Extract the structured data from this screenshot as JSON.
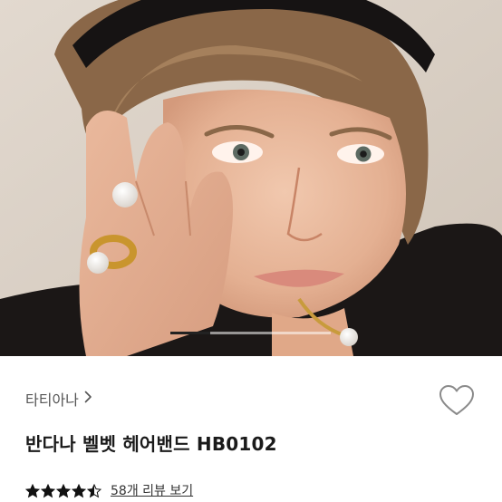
{
  "brand": {
    "name": "타티아나",
    "chevron_icon": "chevron-right-icon"
  },
  "product": {
    "title": "반다나 벨벳 헤어밴드 HB0102"
  },
  "rating": {
    "value": 4.5,
    "max": 5,
    "review_link": "58개 리뷰 보기"
  },
  "carousel": {
    "progress": 0.25
  },
  "wishlist": {
    "icon": "heart-outline-icon"
  },
  "colors": {
    "text": "#1a1a1a",
    "brand_text": "#555555",
    "star": "#111111",
    "heart_outline": "#8a8a8a"
  }
}
